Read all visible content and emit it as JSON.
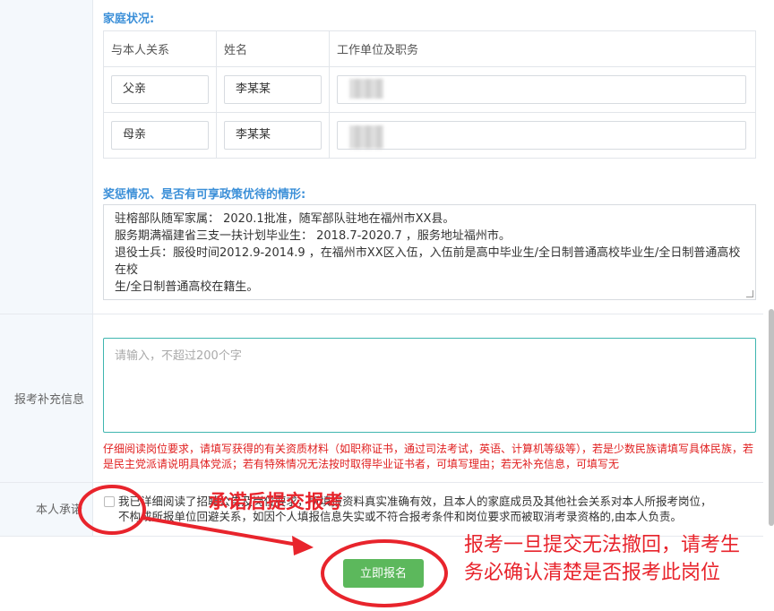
{
  "family": {
    "title": "家庭状况:",
    "headers": [
      "与本人关系",
      "姓名",
      "工作单位及职务"
    ],
    "rows": [
      {
        "relation": "父亲",
        "name": "李某某"
      },
      {
        "relation": "母亲",
        "name": "李某某"
      }
    ]
  },
  "awards": {
    "title": "奖惩情况、是否有可享政策优待的情形:",
    "lines": [
      "驻榕部队随军家属： 2020.1批准，随军部队驻地在福州市XX县。",
      "服务期满福建省三支一扶计划毕业生： 2018.7-2020.7 ，服务地址福州市。",
      "退役士兵：服役时间2012.9-2014.9 ，在福州市XX区入伍，入伍前是高中毕业生/全日制普通高校毕业生/全日制普通高校在校",
      "生/全日制普通高校在籍生。"
    ]
  },
  "supplement": {
    "label": "报考补充信息",
    "placeholder": "请输入，不超过200个字",
    "hint": "仔细阅读岗位要求，请填写获得的有关资质材料（如职称证书，通过司法考试，英语、计算机等级等），若是少数民族请填写具体民族，若是民主党派请说明具体党派；若有特殊情况无法按时取得毕业证书者，可填写理由；若无补充信息，可填写无"
  },
  "promise": {
    "label": "本人承诺",
    "line1": "我已详细阅读了招聘公告及岗位要求，所填报资料真实准确有效，且本人的家庭成员及其他社会关系对本人所报考岗位，",
    "line2": "不构成所报单位回避关系，如因个人填报信息失实或不符合报考条件和岗位要求而被取消考录资格的,由本人负责。"
  },
  "submit_label": "立即报名",
  "annotations": {
    "promise_note": "承诺后提交报考",
    "warning_line1": "报考一旦提交无法撤回，请考生",
    "warning_line2": "务必确认清楚是否报考此岗位"
  },
  "colors": {
    "accent": "#3b8fd8",
    "submit": "#5cb85c",
    "warning": "#e02020",
    "annotation": "#e8242c"
  }
}
